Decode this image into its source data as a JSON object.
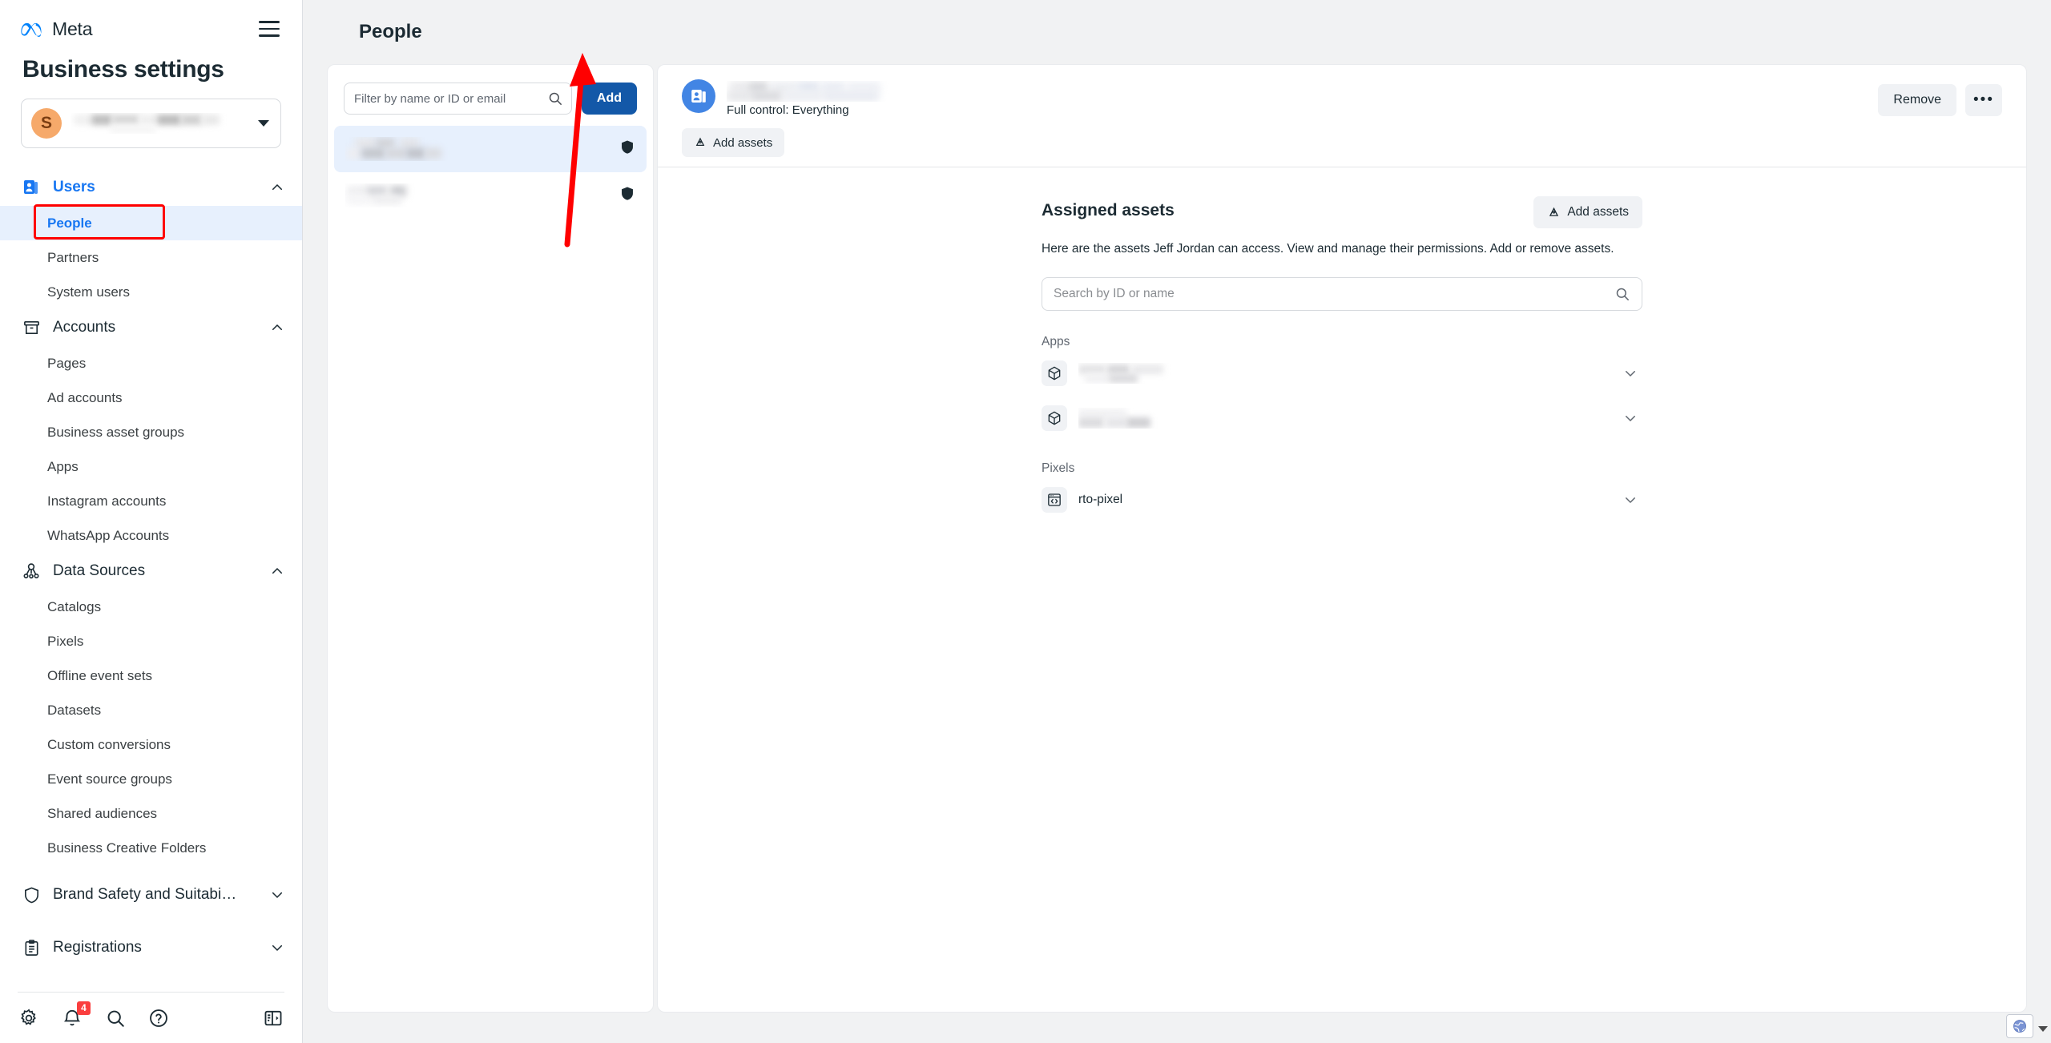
{
  "brand": {
    "name": "Meta",
    "logo_icon": "meta-infinity-logo",
    "menu_icon": "hamburger-menu-icon"
  },
  "sidebar": {
    "heading": "Business settings",
    "business_selector": {
      "avatar_initial": "S",
      "name_redacted": true,
      "chevron_icon": "caret-down-icon"
    },
    "groups": [
      {
        "label": "Users",
        "icon": "users-badge-icon",
        "expanded": true,
        "active": true,
        "chevron_icon": "chevron-up-icon",
        "items": [
          {
            "label": "People",
            "selected": true,
            "annotated": true
          },
          {
            "label": "Partners",
            "selected": false,
            "annotated": false
          },
          {
            "label": "System users",
            "selected": false,
            "annotated": false
          }
        ]
      },
      {
        "label": "Accounts",
        "icon": "archive-box-icon",
        "expanded": true,
        "active": false,
        "chevron_icon": "chevron-up-icon",
        "items": [
          {
            "label": "Pages",
            "selected": false,
            "annotated": false
          },
          {
            "label": "Ad accounts",
            "selected": false,
            "annotated": false
          },
          {
            "label": "Business asset groups",
            "selected": false,
            "annotated": false
          },
          {
            "label": "Apps",
            "selected": false,
            "annotated": false
          },
          {
            "label": "Instagram accounts",
            "selected": false,
            "annotated": false
          },
          {
            "label": "WhatsApp Accounts",
            "selected": false,
            "annotated": false
          }
        ]
      },
      {
        "label": "Data Sources",
        "icon": "data-sources-node-icon",
        "expanded": true,
        "active": false,
        "chevron_icon": "chevron-up-icon",
        "items": [
          {
            "label": "Catalogs",
            "selected": false,
            "annotated": false
          },
          {
            "label": "Pixels",
            "selected": false,
            "annotated": false
          },
          {
            "label": "Offline event sets",
            "selected": false,
            "annotated": false
          },
          {
            "label": "Datasets",
            "selected": false,
            "annotated": false
          },
          {
            "label": "Custom conversions",
            "selected": false,
            "annotated": false
          },
          {
            "label": "Event source groups",
            "selected": false,
            "annotated": false
          },
          {
            "label": "Shared audiences",
            "selected": false,
            "annotated": false
          },
          {
            "label": "Business Creative Folders",
            "selected": false,
            "annotated": false
          }
        ]
      },
      {
        "label": "Brand Safety and Suitabi…",
        "icon": "shield-icon",
        "expanded": false,
        "active": false,
        "chevron_icon": "chevron-down-icon",
        "items": []
      },
      {
        "label": "Registrations",
        "icon": "clipboard-icon",
        "expanded": false,
        "active": false,
        "chevron_icon": "chevron-down-icon",
        "items": []
      }
    ],
    "footer_icons": [
      {
        "name": "gear-icon",
        "badge": null
      },
      {
        "name": "bell-icon",
        "badge": "4"
      },
      {
        "name": "search-icon",
        "badge": null
      },
      {
        "name": "help-circle-icon",
        "badge": null
      },
      {
        "name": "collapse-panel-icon",
        "badge": null
      }
    ]
  },
  "header": {
    "title": "People"
  },
  "people_panel": {
    "filter": {
      "placeholder": "Filter by name or ID or email",
      "value": "",
      "search_icon": "search-icon"
    },
    "add_button": "Add",
    "rows": [
      {
        "name_redacted": true,
        "selected": true,
        "role_icon": "shield-icon"
      },
      {
        "name_redacted": true,
        "selected": false,
        "role_icon": "shield-icon"
      }
    ]
  },
  "detail": {
    "avatar_icon": "user-card-icon",
    "name_redacted": true,
    "subtitle": "Full control: Everything",
    "add_assets_label": "Add assets",
    "add_assets_icon": "add-assets-icon",
    "remove_label": "Remove",
    "more_label": "•••",
    "assets": {
      "title": "Assigned assets",
      "add_button": "Add assets",
      "add_button_icon": "add-assets-icon",
      "description": "Here are the assets Jeff Jordan can access. View and manage their permissions. Add or remove assets.",
      "search_placeholder": "Search by ID or name",
      "search_value": "",
      "search_icon": "search-icon",
      "groups": [
        {
          "label": "Apps",
          "items": [
            {
              "name": "",
              "redacted": true,
              "icon": "cube-icon",
              "chevron_icon": "chevron-down-icon"
            },
            {
              "name": "",
              "redacted": true,
              "icon": "cube-icon",
              "chevron_icon": "chevron-down-icon"
            }
          ]
        },
        {
          "label": "Pixels",
          "items": [
            {
              "name": "rto-pixel",
              "redacted": false,
              "icon": "pixel-code-icon",
              "chevron_icon": "chevron-down-icon"
            }
          ]
        }
      ]
    }
  },
  "annotation": {
    "type": "arrow",
    "color": "#ff0000",
    "points_to": "add-button"
  },
  "statusbar": {
    "globe_icon": "globe-icon"
  },
  "colors": {
    "accent_blue": "#1877f2",
    "primary_button": "#1358a8",
    "selected_row": "#e7f0fd",
    "page_bg": "#f1f2f3",
    "annotation_red": "#ff0000",
    "badge_red": "#fa3e3e",
    "avatar_orange": "#f6a96a"
  }
}
